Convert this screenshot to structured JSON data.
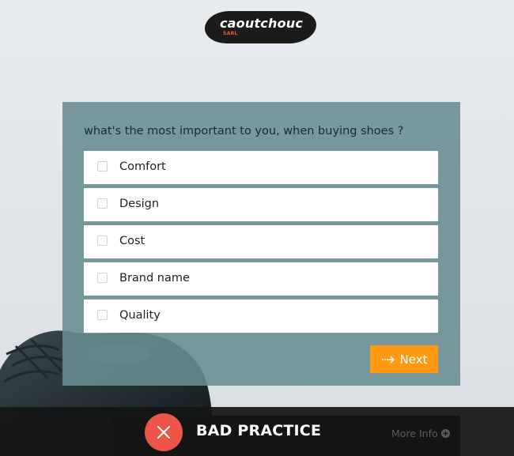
{
  "logo": {
    "brand": "caoutchouc",
    "sub": "SARL"
  },
  "quiz": {
    "question": "what's the most important to you, when buying shoes ?",
    "options": [
      {
        "label": "Comfort",
        "checked": false
      },
      {
        "label": "Design",
        "checked": false
      },
      {
        "label": "Cost",
        "checked": false
      },
      {
        "label": "Brand name",
        "checked": false
      },
      {
        "label": "Quality",
        "checked": false
      }
    ],
    "next_label": "Next",
    "next_icon": "dotted-arrow-right-icon"
  },
  "banner": {
    "verdict": "BAD PRACTICE",
    "verdict_icon": "close-icon",
    "more_info": "More Info",
    "more_info_icon": "plus-circle-icon"
  },
  "colors": {
    "panel": "#688c91",
    "next_button": "#ff9a12",
    "bad_icon": "#ee5549",
    "logo_sub": "#e85a3b"
  }
}
